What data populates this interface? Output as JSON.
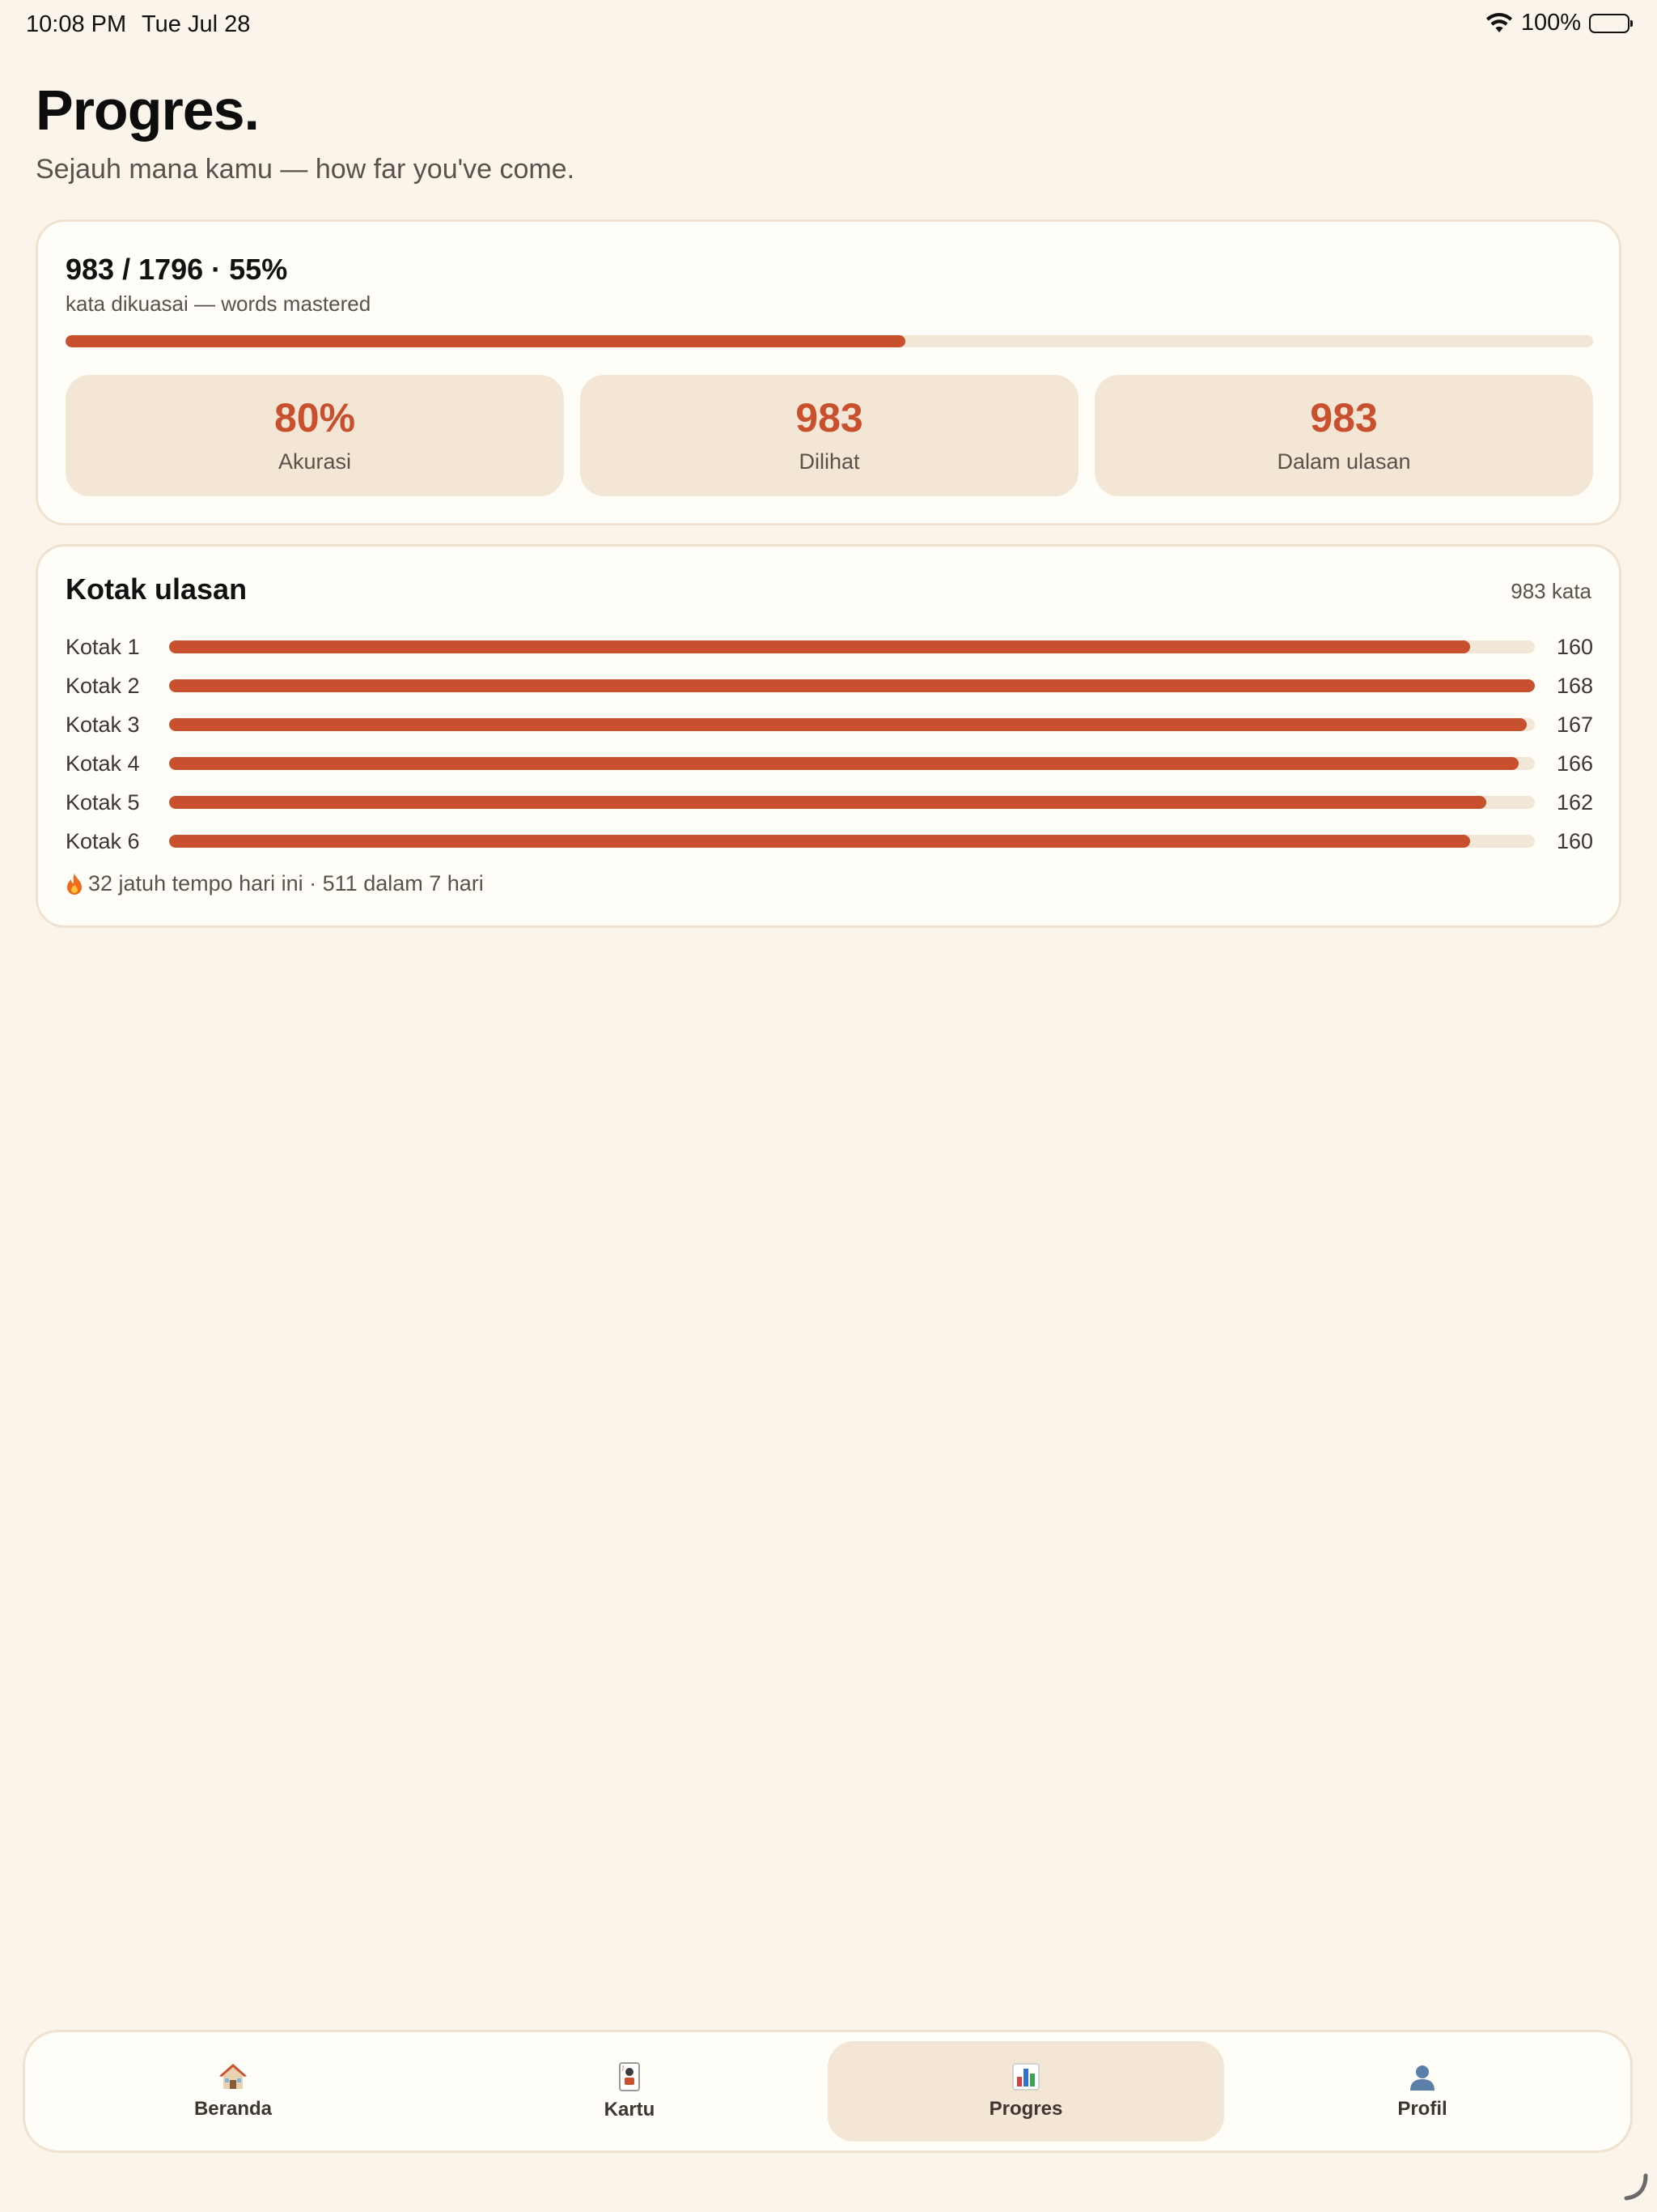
{
  "status_bar": {
    "time": "10:08 PM",
    "date": "Tue Jul 28",
    "battery": "100%"
  },
  "header": {
    "title": "Progres.",
    "subtitle": "Sejauh mana kamu — how far you've come."
  },
  "mastery": {
    "headline": "983 / 1796 · 55%",
    "caption": "kata dikuasai — words mastered",
    "progress": 0.55,
    "stats": [
      {
        "value": "80%",
        "label": "Akurasi"
      },
      {
        "value": "983",
        "label": "Dilihat"
      },
      {
        "value": "983",
        "label": "Dalam ulasan"
      }
    ]
  },
  "review_boxes": {
    "title": "Kotak ulasan",
    "total": "983 kata",
    "max": 168,
    "rows": [
      {
        "label": "Kotak 1",
        "count": 160
      },
      {
        "label": "Kotak 2",
        "count": 168
      },
      {
        "label": "Kotak 3",
        "count": 167
      },
      {
        "label": "Kotak 4",
        "count": 166
      },
      {
        "label": "Kotak 5",
        "count": 162
      },
      {
        "label": "Kotak 6",
        "count": 160
      }
    ],
    "due_text": "32 jatuh tempo hari ini · 511 dalam 7 hari"
  },
  "tab_bar": {
    "active": "Progres",
    "tabs": [
      {
        "label": "Beranda",
        "icon": "house-icon"
      },
      {
        "label": "Kartu",
        "icon": "cards-icon"
      },
      {
        "label": "Progres",
        "icon": "bar-chart-icon"
      },
      {
        "label": "Profil",
        "icon": "person-icon"
      }
    ]
  },
  "colors": {
    "accent": "#c9502f",
    "background": "#faf4ea",
    "card": "#fffdf8",
    "tile": "#f3e6d4"
  }
}
